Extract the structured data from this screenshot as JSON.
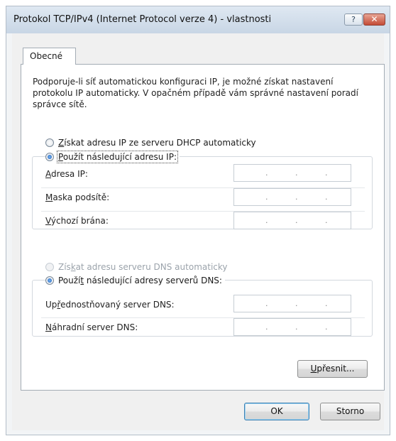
{
  "window": {
    "title": "Protokol TCP/IPv4 (Internet Protocol verze 4) - vlastnosti",
    "help_label": "?",
    "close_label": "✕"
  },
  "tabs": [
    {
      "label": "Obecné",
      "active": true
    }
  ],
  "description": "Podporuje-li síť automatickou konfiguraci IP, je možné získat nastavení protokolu IP automaticky. V opačném případě vám správné nastavení poradí správce sítě.",
  "ip_mode": {
    "auto": {
      "mnemonic": "Z",
      "rest": "ískat adresu IP ze serveru DHCP automaticky",
      "checked": false
    },
    "manual": {
      "mnemonic": "P",
      "rest": "oužít následující adresu IP:",
      "checked": true
    }
  },
  "ip_fields": [
    {
      "mnemonic": "A",
      "rest": "dresa IP:",
      "value": ". . ."
    },
    {
      "mnemonic": "M",
      "rest": "aska podsítě:",
      "value": ". . ."
    },
    {
      "mnemonic": "V",
      "rest": "ýchozí brána:",
      "value": ". . ."
    }
  ],
  "dns_mode": {
    "auto": {
      "pre": "Zís",
      "mnemonic": "k",
      "rest": "at adresu serveru DNS automaticky",
      "checked": false,
      "disabled": true
    },
    "manual": {
      "pre": "Použí",
      "mnemonic": "t",
      "rest": " následující adresy serverů DNS:",
      "checked": true
    }
  },
  "dns_fields": [
    {
      "pre": "Up",
      "mnemonic": "ř",
      "rest": "ednostňovaný server DNS:",
      "value": ". . ."
    },
    {
      "pre": "",
      "mnemonic": "N",
      "rest": "áhradní server DNS:",
      "value": ". . ."
    }
  ],
  "buttons": {
    "advanced": {
      "mnemonic": "U",
      "rest": "přesnit..."
    },
    "ok": "OK",
    "cancel": "Storno"
  },
  "colors": {
    "title_bar": "#c8d6e5",
    "close_button": "#c44b36",
    "radio_checked": "#1b5fb8"
  }
}
